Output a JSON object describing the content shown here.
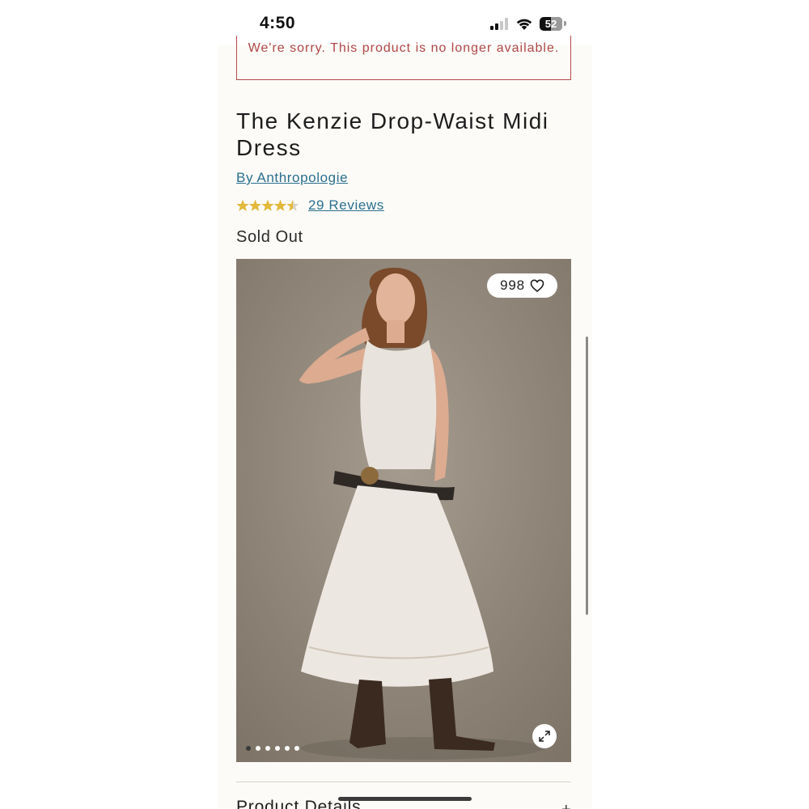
{
  "status_bar": {
    "time": "4:50",
    "battery": "52",
    "signal_icon": "cellular-signal-icon",
    "wifi_icon": "wifi-icon"
  },
  "alert": {
    "message": "We're sorry. This product is no longer available.",
    "color": "#b04848"
  },
  "product": {
    "title": "The Kenzie Drop-Waist Midi Dress",
    "brand_link": "By Anthropologie",
    "rating": 4.5,
    "rating_max": 5,
    "reviews_link": "29 Reviews",
    "stock_status": "Sold Out",
    "star_color": "#e3b93b"
  },
  "gallery": {
    "favorite_count": "998",
    "favorite_icon": "heart-outline-icon",
    "expand_icon": "expand-arrows-icon",
    "slide_count": 6,
    "active_slide": 1
  },
  "accordion": {
    "product_details_label": "Product Details",
    "toggle_icon": "plus-icon"
  },
  "colors": {
    "link": "#2a6f8e",
    "page_background": "#fcfbf7",
    "alert_border": "#b54a4a"
  }
}
